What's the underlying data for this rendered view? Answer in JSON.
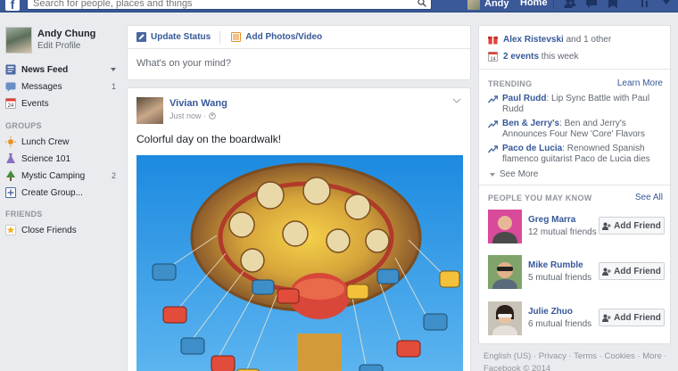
{
  "topbar": {
    "logo": "f",
    "search_placeholder": "Search for people, places and things",
    "user_name": "Andy",
    "home_label": "Home",
    "icons": [
      "search-icon",
      "friend-requests-icon",
      "messages-icon",
      "notifications-icon",
      "privacy-icon",
      "settings-icon"
    ]
  },
  "leftnav": {
    "me": {
      "name": "Andy Chung",
      "edit": "Edit Profile"
    },
    "items": [
      {
        "label": "News Feed",
        "icon": "news-feed-icon",
        "count": "",
        "active": true
      },
      {
        "label": "Messages",
        "icon": "messages-icon",
        "count": "1"
      },
      {
        "label": "Events",
        "icon": "calendar-icon",
        "count": ""
      }
    ],
    "groups_head": "GROUPS",
    "groups": [
      {
        "label": "Lunch Crew",
        "icon": "sun-icon",
        "count": ""
      },
      {
        "label": "Science 101",
        "icon": "flask-icon",
        "count": ""
      },
      {
        "label": "Mystic Camping",
        "icon": "tree-icon",
        "count": "2"
      },
      {
        "label": "Create Group...",
        "icon": "plus-icon",
        "count": ""
      }
    ],
    "friends_head": "FRIENDS",
    "friends": [
      {
        "label": "Close Friends",
        "icon": "star-icon",
        "count": ""
      }
    ]
  },
  "composer": {
    "update_status": "Update Status",
    "add_photos": "Add Photos/Video",
    "placeholder": "What's on your mind?"
  },
  "post": {
    "author": "Vivian Wang",
    "time": "Just now · ",
    "text": "Colorful day on the boardwalk!"
  },
  "rightcol": {
    "birthday": {
      "name": "Alex Ristevski",
      "rest": " and 1 other"
    },
    "events": {
      "count": "2 events",
      "rest": " this week",
      "day": "14"
    },
    "trending_head": "TRENDING",
    "learn_more": "Learn More",
    "trends": [
      {
        "topic": "Paul Rudd",
        "desc": ": Lip Sync Battle with Paul Rudd"
      },
      {
        "topic": "Ben & Jerry's",
        "desc": ": Ben and Jerry's Announces Four New 'Core' Flavors"
      },
      {
        "topic": "Paco de Lucia",
        "desc": ": Renowned Spanish flamenco guitarist Paco de Lucia dies"
      }
    ],
    "see_more": "See More",
    "pymk_head": "PEOPLE YOU MAY KNOW",
    "see_all": "See All",
    "people": [
      {
        "name": "Greg Marra",
        "mutual": "12 mutual friends",
        "button": "Add Friend"
      },
      {
        "name": "Mike Rumble",
        "mutual": "5 mutual friends",
        "button": "Add Friend"
      },
      {
        "name": "Julie Zhuo",
        "mutual": "6 mutual friends",
        "button": "Add Friend"
      }
    ]
  },
  "footer": {
    "links": "English (US) · Privacy · Terms · Cookies · More ·",
    "copyright": "Facebook © 2014"
  },
  "colors": {
    "brand": "#3b5998",
    "link": "#365899",
    "background": "#e9ebee"
  }
}
